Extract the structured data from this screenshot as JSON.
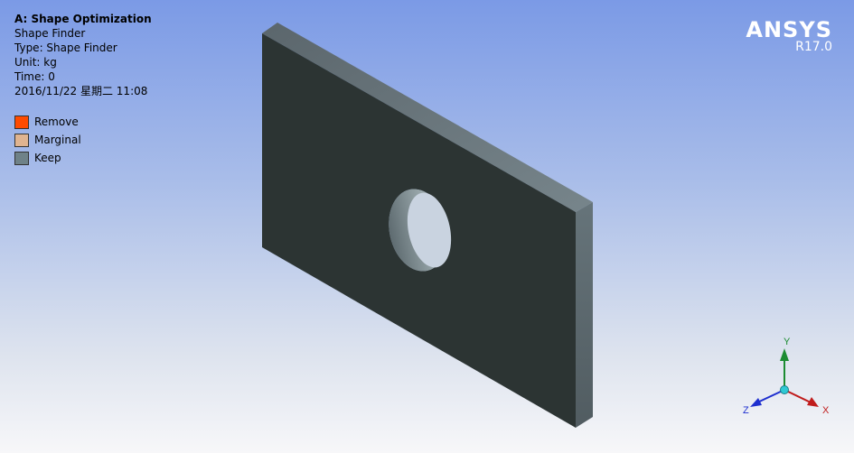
{
  "info": {
    "title": "A: Shape Optimization",
    "line1": "Shape Finder",
    "line2": "Type: Shape Finder",
    "line3": "Unit: kg",
    "line4": "Time: 0",
    "line5": "2016/11/22 星期二 11:08"
  },
  "legend": {
    "items": [
      {
        "label": "Remove",
        "color": "#ff4b00"
      },
      {
        "label": "Marginal",
        "color": "#e0b490"
      },
      {
        "label": "Keep",
        "color": "#6f8288"
      }
    ]
  },
  "logo": {
    "brand": "ANSYS",
    "version": "R17.0"
  },
  "triad": {
    "x_label": "X",
    "y_label": "Y",
    "z_label": "Z"
  }
}
